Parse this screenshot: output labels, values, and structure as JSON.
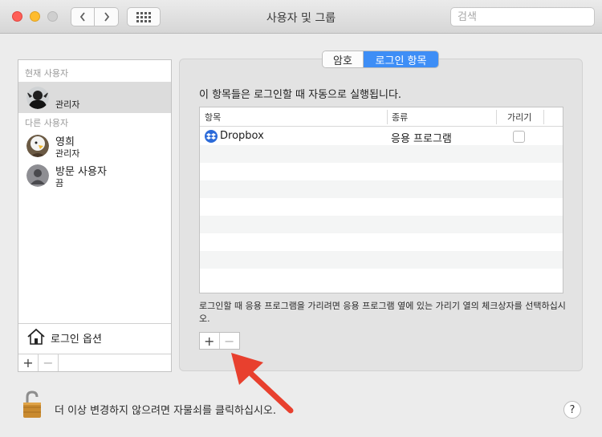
{
  "window": {
    "title": "사용자 및 그룹"
  },
  "search": {
    "placeholder": "검색"
  },
  "sidebar": {
    "current_user_header": "현재 사용자",
    "other_users_header": "다른 사용자",
    "current_user": {
      "role": "관리자"
    },
    "other_users": [
      {
        "name": "영희",
        "role": "관리자"
      },
      {
        "name": "방문 사용자",
        "role": "끔"
      }
    ],
    "login_options": "로그인 옵션",
    "add_label": "+",
    "remove_label": "−"
  },
  "tabs": [
    {
      "label": "암호",
      "selected": false
    },
    {
      "label": "로그인 항목",
      "selected": true
    }
  ],
  "main": {
    "description": "이 항목들은 로그인할 때 자동으로 실행됩니다.",
    "columns": [
      "항목",
      "종류",
      "가리기"
    ],
    "rows": [
      {
        "item": "Dropbox",
        "kind": "응용 프로그램",
        "hide": false
      }
    ],
    "help_text": "로그인할 때 응용 프로그램을 가리려면 응용 프로그램 옆에 있는 가리기 열의 체크상자를 선택하십시오.",
    "add_label": "+",
    "remove_label": "−"
  },
  "footer": {
    "lock_text": "더 이상 변경하지 않으려면 자물쇠를 클릭하십시오.",
    "help_label": "?"
  },
  "colors": {
    "accent": "#3e8ef6",
    "arrow": "#e8402e"
  }
}
